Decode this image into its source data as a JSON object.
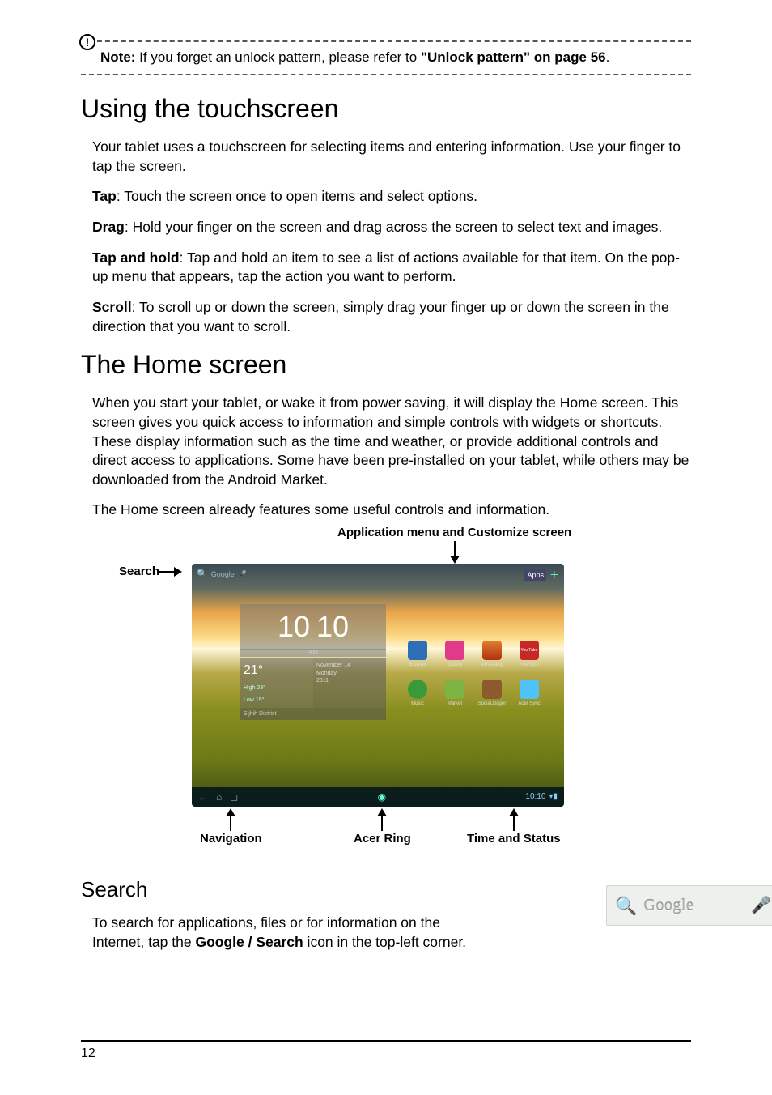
{
  "note": {
    "label": "Note:",
    "text": " If you forget an unlock pattern, please refer to ",
    "linkText": "\"Unlock pattern\" on page 56",
    "end": "."
  },
  "h1a": "Using the touchscreen",
  "p1": "Your tablet uses a touchscreen for selecting items and entering information. Use your finger to tap the screen.",
  "tap": {
    "label": "Tap",
    "text": ": Touch the screen once to open items and select options."
  },
  "drag": {
    "label": "Drag",
    "text": ": Hold your finger on the screen and drag across the screen to select text and images."
  },
  "taphold": {
    "label": "Tap and hold",
    "text": ": Tap and hold an item to see a list of actions available for that item. On the pop-up menu that appears, tap the action you want to perform."
  },
  "scroll": {
    "label": "Scroll",
    "text": ": To scroll up or down the screen, simply drag your finger up or down the screen in the direction that you want to scroll."
  },
  "h1b": "The Home screen",
  "p2": "When you start your tablet, or wake it from power saving, it will display the Home screen. This screen gives you quick access to information and simple controls with widgets or shortcuts. These display information such as the time and weather, or provide additional controls and direct access to applications. Some have been pre-installed on your tablet, while others may be downloaded from the Android Market.",
  "p3": "The Home screen already features some useful controls and information.",
  "labels": {
    "appmenu": "Application menu and Customize screen",
    "search": "Search",
    "nav": "Navigation",
    "ring": "Acer Ring",
    "time": "Time and Status"
  },
  "tablet": {
    "searchHint": "Google",
    "appsLabel": "Apps",
    "clock": {
      "h": "10",
      "m": "10",
      "ampm": "AM"
    },
    "weather": {
      "temp": "21°",
      "date1": "November 14",
      "date2": "Monday",
      "date3": "2011",
      "high": "High   23°",
      "low": "Low    19°",
      "loc": "Sijhih District"
    },
    "icons": [
      "Browser",
      "Gallery",
      "eReading",
      "YouTube",
      "Music",
      "Market",
      "SocialJogger",
      "Acer Sync"
    ],
    "navTime": "10:10"
  },
  "h2": "Search",
  "p4a": "To search for applications, files or for information on the Internet, tap the ",
  "p4bold": "Google / Search",
  "p4b": " icon in the top-left corner.",
  "searchWidget": {
    "text": "Google"
  },
  "pageNum": "12"
}
